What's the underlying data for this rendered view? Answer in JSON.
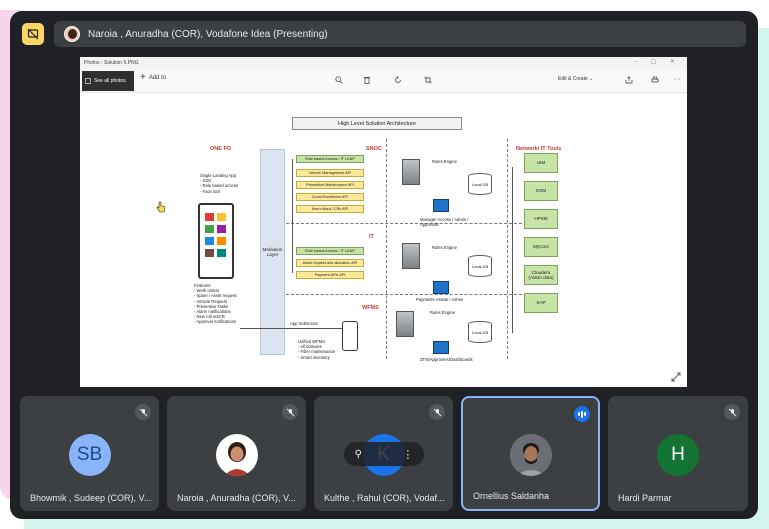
{
  "presenter_bar": {
    "text": "Naroia , Anuradha (COR), Vodafone Idea (Presenting)",
    "present_icon": "screen-share-off-icon"
  },
  "photos_app": {
    "window_title": "Photos - Solution 5.PNG",
    "see_all_label": "See all photos",
    "add_to_label": "Add to",
    "edit_create_label": "Edit & Create",
    "toolbar_icons": [
      "zoom-icon",
      "delete-icon",
      "rotate-icon",
      "crop-icon",
      "share-icon",
      "print-icon",
      "more-icon"
    ]
  },
  "diagram": {
    "title": "High Level Solution Architecture",
    "one_fo": "ONE FO",
    "snoc": "SNOC",
    "it": "IT",
    "wfms": "WFMS",
    "network_it_tools": "Network/ IT Tools",
    "single_landing": "Single Landing App\n- SSO\n- Role based access\n- Face lock",
    "features": "Features\n- Work orders\n- Spare / Asset request\n- Vehicle Request\n- Preventive Tasks\n- Alarm notifications\n- New roll outCR\n- Approval notifications",
    "mediation_layer": "Mediation\nLayer",
    "snoc_apis": [
      "Role based Access / IT LDAP",
      "Vehicle Management API",
      "Preventive Maintenance API",
      "Zonal Excellence API",
      "New rollout / CRs API"
    ],
    "it_apis": [
      "Role based Access / IT LDAP",
      "Asset request and allocation API",
      "Payment APIs API"
    ],
    "rules_engine": "Rules Engine",
    "local_db": "Local DB",
    "snoc_approver": "Manager Access / Admin /\nApprovals",
    "it_approver": "Payments Assets / Admin",
    "wfms_approver": "ZTM/Approvers/Dashboards",
    "app_redirection": "App redirection",
    "unified_wfms": "Unified WFMS\n- All domains\n- Fiber maintenance\n- Smart inventory",
    "tools": [
      "UIM",
      "OSM",
      "HPSM",
      "MyCom",
      "Cloudera\n(Alarm data)",
      "SAP"
    ]
  },
  "participants": [
    {
      "name": "Bhowmik , Sudeep (COR), V...",
      "initials": "SB",
      "avatar_color": "#8ab4f8",
      "text_color": "#1a4c8f",
      "muted": true,
      "speaking": false
    },
    {
      "name": "Naroia , Anuradha (COR), V...",
      "initials": "",
      "avatar_color": "#ffffff",
      "text_color": "#000000",
      "muted": true,
      "speaking": false
    },
    {
      "name": "Kulthe , Rahul (COR), Vodaf...",
      "initials": "K",
      "avatar_color": "#1a73e8",
      "text_color": "#ffffff",
      "muted": true,
      "speaking": false
    },
    {
      "name": "Ornellius Saldanha",
      "initials": "",
      "avatar_color": "#5f6368",
      "text_color": "#ffffff",
      "muted": false,
      "speaking": true
    },
    {
      "name": "Hardi Parmar",
      "initials": "H",
      "avatar_color": "#137333",
      "text_color": "#ffffff",
      "muted": true,
      "speaking": false
    }
  ]
}
